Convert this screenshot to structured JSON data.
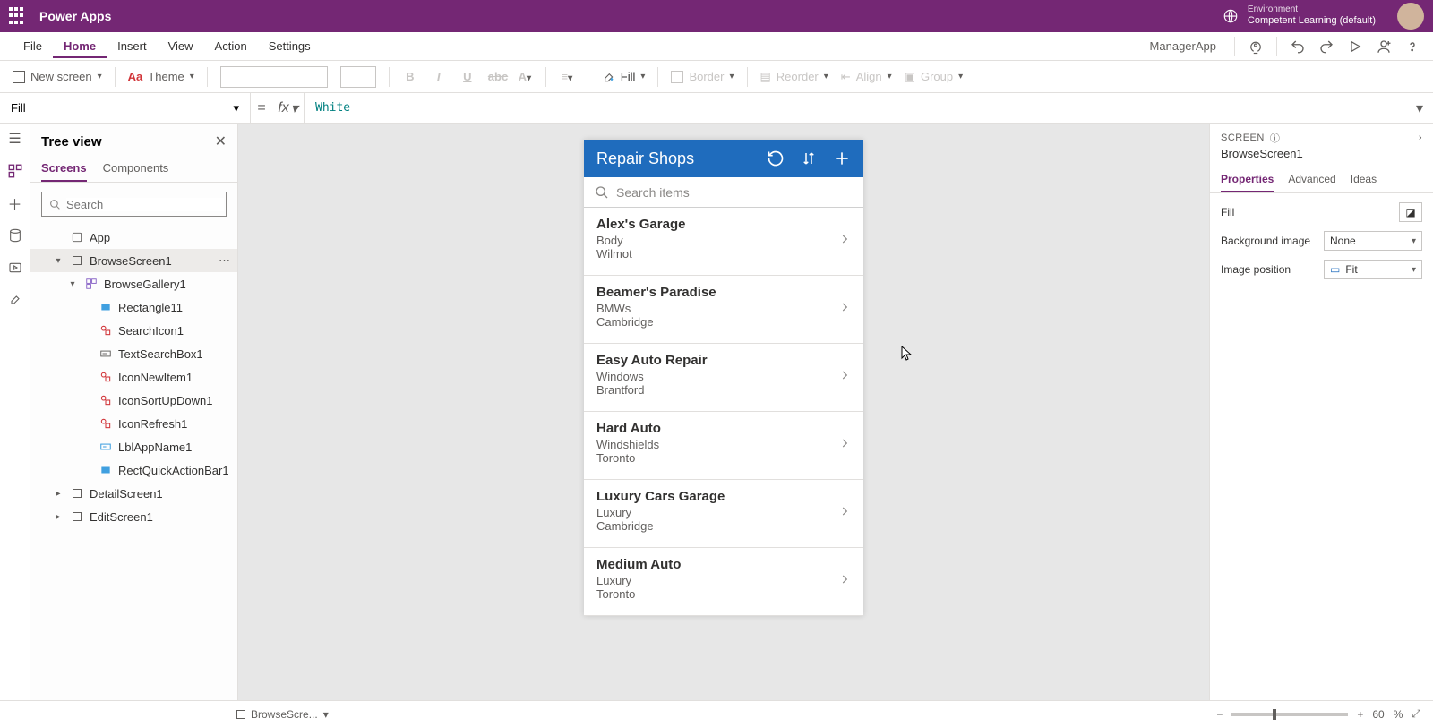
{
  "titlebar": {
    "app_name": "Power Apps",
    "env_label": "Environment",
    "env_name": "Competent Learning (default)"
  },
  "menu": {
    "items": [
      "File",
      "Home",
      "Insert",
      "View",
      "Action",
      "Settings"
    ],
    "active": "Home",
    "doc_name": "ManagerApp"
  },
  "ribbon": {
    "new_screen": "New screen",
    "theme": "Theme",
    "fill": "Fill",
    "border": "Border",
    "reorder": "Reorder",
    "align": "Align",
    "group": "Group"
  },
  "formula": {
    "property": "Fill",
    "value": "White"
  },
  "tree": {
    "title": "Tree view",
    "tabs": [
      "Screens",
      "Components"
    ],
    "active_tab": "Screens",
    "search_placeholder": "Search",
    "nodes": [
      {
        "indent": 1,
        "expandable": false,
        "label": "App",
        "icon": "app"
      },
      {
        "indent": 1,
        "expandable": true,
        "expanded": true,
        "label": "BrowseScreen1",
        "icon": "screen",
        "selected": true
      },
      {
        "indent": 2,
        "expandable": true,
        "expanded": true,
        "label": "BrowseGallery1",
        "icon": "gallery"
      },
      {
        "indent": 3,
        "expandable": false,
        "label": "Rectangle11",
        "icon": "rect"
      },
      {
        "indent": 3,
        "expandable": false,
        "label": "SearchIcon1",
        "icon": "iconctl"
      },
      {
        "indent": 3,
        "expandable": false,
        "label": "TextSearchBox1",
        "icon": "text"
      },
      {
        "indent": 3,
        "expandable": false,
        "label": "IconNewItem1",
        "icon": "iconctl"
      },
      {
        "indent": 3,
        "expandable": false,
        "label": "IconSortUpDown1",
        "icon": "iconctl"
      },
      {
        "indent": 3,
        "expandable": false,
        "label": "IconRefresh1",
        "icon": "iconctl"
      },
      {
        "indent": 3,
        "expandable": false,
        "label": "LblAppName1",
        "icon": "label"
      },
      {
        "indent": 3,
        "expandable": false,
        "label": "RectQuickActionBar1",
        "icon": "rect"
      },
      {
        "indent": 1,
        "expandable": true,
        "expanded": false,
        "label": "DetailScreen1",
        "icon": "screen"
      },
      {
        "indent": 1,
        "expandable": true,
        "expanded": false,
        "label": "EditScreen1",
        "icon": "screen"
      }
    ]
  },
  "phone": {
    "title": "Repair Shops",
    "search_placeholder": "Search items",
    "items": [
      {
        "title": "Alex's Garage",
        "sub1": "Body",
        "sub2": "Wilmot"
      },
      {
        "title": "Beamer's Paradise",
        "sub1": "BMWs",
        "sub2": "Cambridge"
      },
      {
        "title": "Easy Auto Repair",
        "sub1": "Windows",
        "sub2": "Brantford"
      },
      {
        "title": "Hard Auto",
        "sub1": "Windshields",
        "sub2": "Toronto"
      },
      {
        "title": "Luxury Cars Garage",
        "sub1": "Luxury",
        "sub2": "Cambridge"
      },
      {
        "title": "Medium Auto",
        "sub1": "Luxury",
        "sub2": "Toronto"
      }
    ]
  },
  "props": {
    "section": "SCREEN",
    "selected": "BrowseScreen1",
    "tabs": [
      "Properties",
      "Advanced",
      "Ideas"
    ],
    "active_tab": "Properties",
    "rows": {
      "fill_label": "Fill",
      "bgimg_label": "Background image",
      "bgimg_value": "None",
      "imgpos_label": "Image position",
      "imgpos_value": "Fit"
    }
  },
  "status": {
    "selection": "BrowseScre...",
    "zoom": "60",
    "zoom_unit": "%"
  }
}
